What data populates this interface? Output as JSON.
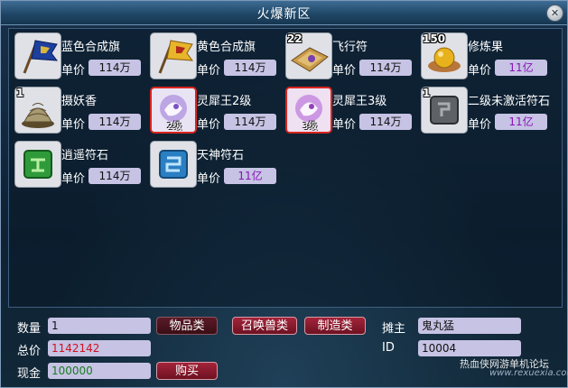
{
  "window": {
    "title": "火爆新区",
    "close_icon": "close-icon"
  },
  "price_label": "单价",
  "items": [
    {
      "name": "蓝色合成旗",
      "price": "114万",
      "quantity": "",
      "icon": "blue-flag-icon",
      "selected": false,
      "badge": ""
    },
    {
      "name": "黄色合成旗",
      "price": "114万",
      "quantity": "",
      "icon": "yellow-flag-icon",
      "selected": false,
      "badge": ""
    },
    {
      "name": "飞行符",
      "price": "114万",
      "quantity": "22",
      "icon": "flight-talisman-icon",
      "selected": false,
      "badge": ""
    },
    {
      "name": "修炼果",
      "price": "11亿",
      "quantity": "150",
      "icon": "cultivation-fruit-icon",
      "selected": false,
      "badge": ""
    },
    {
      "name": "摄妖香",
      "price": "114万",
      "quantity": "1",
      "icon": "incense-icon",
      "selected": false,
      "badge": ""
    },
    {
      "name": "灵犀王2级",
      "price": "114万",
      "quantity": "",
      "icon": "spirit-rhino-icon",
      "selected": true,
      "badge": "2级"
    },
    {
      "name": "灵犀王3级",
      "price": "114万",
      "quantity": "",
      "icon": "spirit-rhino-icon",
      "selected": true,
      "badge": "3级"
    },
    {
      "name": "二级未激活符石",
      "price": "11亿",
      "quantity": "1",
      "icon": "inactive-runestone-icon",
      "selected": false,
      "badge": ""
    },
    {
      "name": "逍遥符石",
      "price": "114万",
      "quantity": "",
      "icon": "green-runestone-icon",
      "selected": false,
      "badge": ""
    },
    {
      "name": "天神符石",
      "price": "11亿",
      "quantity": "",
      "icon": "blue-runestone-icon",
      "selected": false,
      "badge": ""
    }
  ],
  "footer": {
    "quantity_label": "数量",
    "quantity_value": "1",
    "total_label": "总价",
    "total_value": "1142142",
    "cash_label": "现金",
    "cash_value": "100000",
    "tab_items": "物品类",
    "tab_pets": "召唤兽类",
    "tab_craft": "制造类",
    "buy_button": "购买",
    "owner_label": "摊主",
    "owner_value": "鬼丸猛",
    "id_label": "ID",
    "id_value": "10004"
  },
  "watermark": {
    "line1": "热血侠网游单机论坛",
    "line2": "www.rexuexia.com"
  },
  "colors": {
    "window_bg": "#13263a",
    "field_bg": "#c6c3e4",
    "total_price": "#d0121e",
    "cash": "#1a7a22",
    "price_yi": "#8a12b8",
    "button": "#8b1a2c",
    "selection_border": "#d8261f"
  }
}
